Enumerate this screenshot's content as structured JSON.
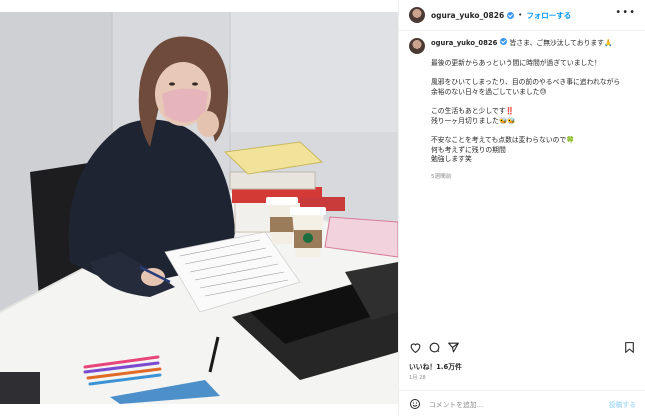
{
  "post": {
    "username": "ogura_yuko_0826",
    "header_separator": "•",
    "follow_label": "フォローする",
    "more_label": "•••",
    "caption_lines": [
      "皆さま、ご無沙汰しております🙏",
      "最後の更新からあっという間に時間が過ぎていました！",
      "風邪をひいてしまったり、目の前のやるべき事に追われながら\n余裕のない日々を過ごしていました😓",
      "この生活もあと少しです‼️\n残り一ヶ月切りました🐝🐝",
      "不安なことを考えても点数は変わらないので🍀\n何も考えずに残りの期間\n勉強します笑"
    ],
    "time_ago": "5週間前",
    "likes": "いいね！1.6万件",
    "date": "1月 28",
    "comment_placeholder": "コメントを追加...",
    "post_button": "投稿する"
  },
  "icons": {
    "heart": "heart-icon",
    "comment": "comment-icon",
    "share": "share-icon",
    "bookmark": "bookmark-icon",
    "emoji": "emoji-icon"
  },
  "colors": {
    "link_blue": "#0095f6",
    "verified_blue": "#3897f0",
    "muted": "#8e8e8e",
    "post_disabled": "#b2dffc"
  }
}
